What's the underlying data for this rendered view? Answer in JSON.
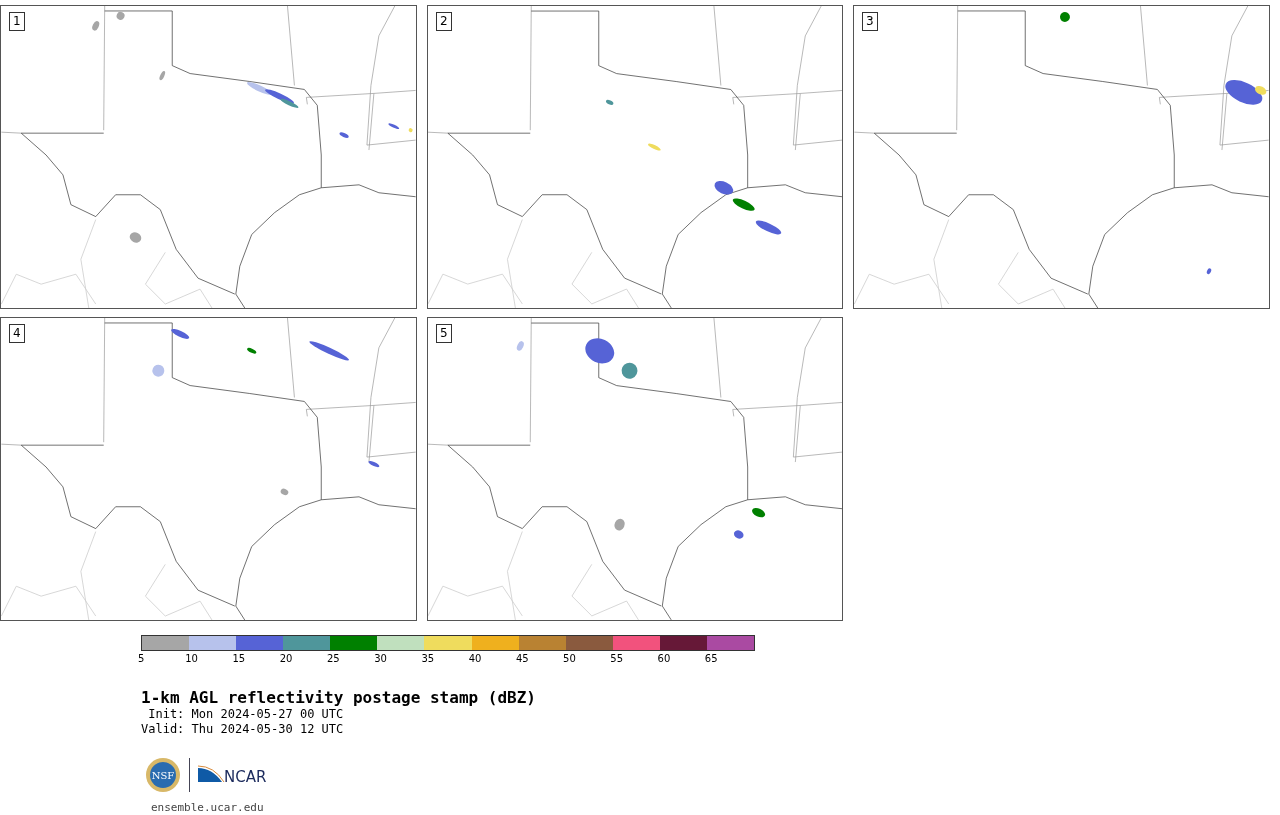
{
  "panels": [
    {
      "label": "1"
    },
    {
      "label": "2"
    },
    {
      "label": "3"
    },
    {
      "label": "4"
    },
    {
      "label": "5"
    }
  ],
  "colorbar": {
    "bins": [
      {
        "color": "#a6a6a6"
      },
      {
        "color": "#b7c2ec"
      },
      {
        "color": "#5663d6"
      },
      {
        "color": "#4f969b"
      },
      {
        "color": "#008000"
      },
      {
        "color": "#c0e0be"
      },
      {
        "color": "#efdc5d"
      },
      {
        "color": "#efb01e"
      },
      {
        "color": "#b98232"
      },
      {
        "color": "#8a5a3e"
      },
      {
        "color": "#f2527d"
      },
      {
        "color": "#661837"
      },
      {
        "color": "#aa4aa2"
      }
    ],
    "ticks": [
      "5",
      "10",
      "15",
      "20",
      "25",
      "30",
      "35",
      "40",
      "45",
      "50",
      "55",
      "60",
      "65"
    ]
  },
  "title": "1-km AGL reflectivity postage stamp (dBZ)",
  "init": " Init: Mon 2024-05-27 00 UTC",
  "valid": "Valid: Thu 2024-05-30 12 UTC",
  "logos": {
    "nsf": "NSF",
    "ncar": "NCAR"
  },
  "url": "ensemble.ucar.edu"
}
